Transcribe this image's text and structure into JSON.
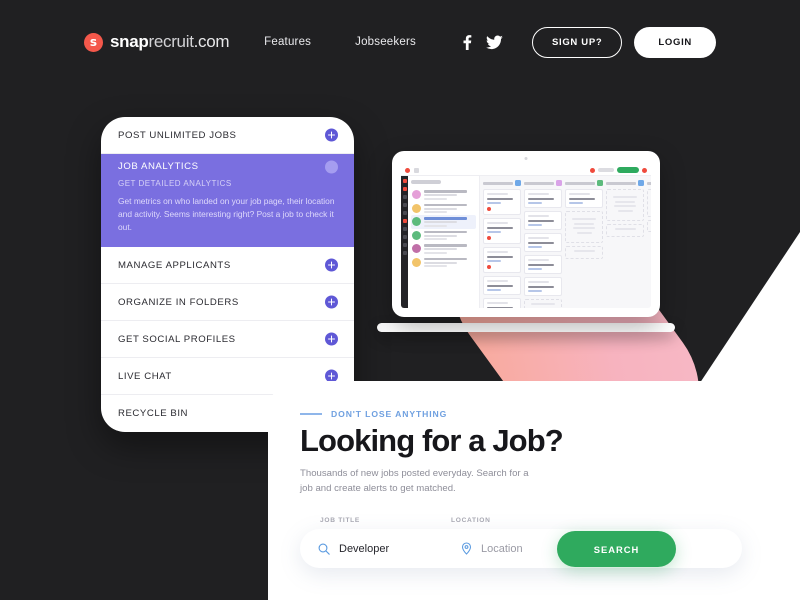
{
  "site": {
    "logo": {
      "badge_letter": "s",
      "word1": "snap",
      "word2": "recruit",
      "word3": ".com"
    }
  },
  "nav": {
    "links": [
      {
        "label": "Features"
      },
      {
        "label": "Jobseekers"
      }
    ],
    "social": [
      {
        "name": "facebook-icon"
      },
      {
        "name": "twitter-icon"
      }
    ],
    "signup_label": "SIGN UP?",
    "login_label": "LOGIN"
  },
  "accordion": {
    "items": [
      {
        "title": "POST UNLIMITED JOBS",
        "expanded": false,
        "toggle": "plus-icon"
      },
      {
        "title": "JOB ANALYTICS",
        "expanded": true,
        "toggle": "minus-icon",
        "subtitle": "GET DETAILED ANALYTICS",
        "description": "Get metrics on who landed on your job page, their location and activity. Seems interesting right? Post a job to check it out."
      },
      {
        "title": "MANAGE APPLICANTS",
        "expanded": false,
        "toggle": "plus-icon"
      },
      {
        "title": "ORGANIZE IN FOLDERS",
        "expanded": false,
        "toggle": "plus-icon"
      },
      {
        "title": "GET SOCIAL PROFILES",
        "expanded": false,
        "toggle": "plus-icon"
      },
      {
        "title": "LIVE CHAT",
        "expanded": false,
        "toggle": "plus-icon"
      },
      {
        "title": "RECYCLE BIN",
        "expanded": false,
        "toggle": "plus-icon"
      }
    ]
  },
  "job_card": {
    "eyebrow": "DON'T LOSE ANYTHING",
    "title": "Looking for a Job?",
    "description": "Thousands of new jobs posted everyday. Search for a job and create alerts to get matched.",
    "job_title_label": "JOB TITLE",
    "location_label": "LOCATION",
    "job_title_value": "Developer",
    "location_placeholder": "Location",
    "search_label": "SEARCH"
  },
  "colors": {
    "background_dark": "#202022",
    "accent_purple": "#7a6fe0",
    "toggle_purple": "#5f58d6",
    "brand_coral": "#f4584b",
    "search_green": "#2faa5e",
    "eyebrow_blue": "#6fa0e0",
    "pink_shape_light": "#f7b9c6",
    "pink_shape_dark": "#f9a895"
  }
}
